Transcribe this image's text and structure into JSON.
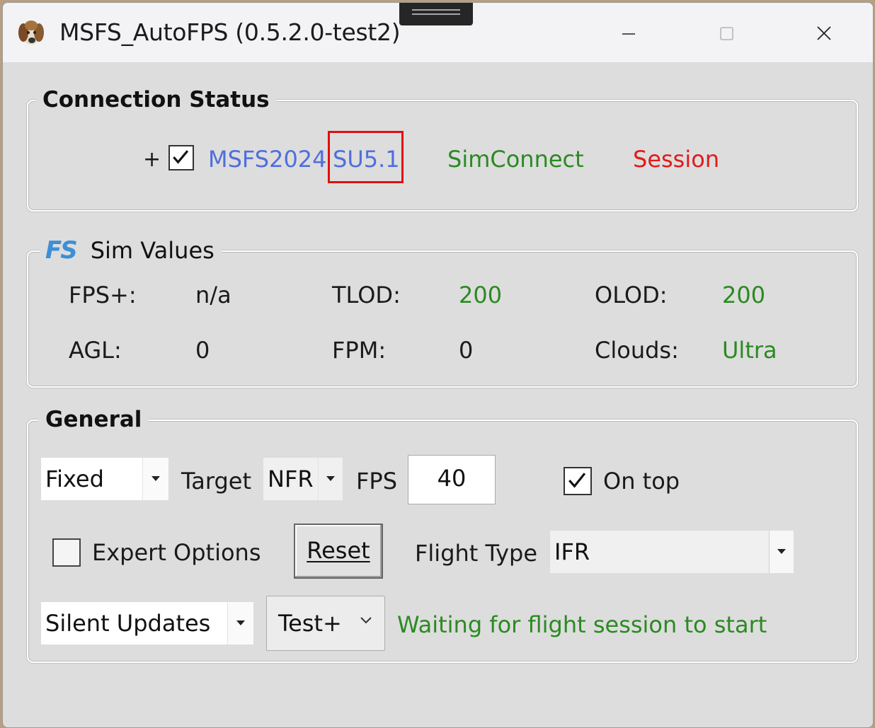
{
  "window": {
    "title": "MSFS_AutoFPS (0.5.2.0-test2)"
  },
  "connection": {
    "legend": "Connection Status",
    "expand": "+",
    "sim_name": "MSFS2024",
    "sim_version": "SU5.1",
    "simconnect": "SimConnect",
    "session": "Session",
    "sim_checked": true
  },
  "sim_values": {
    "legend": "Sim Values",
    "logo_text": "FS",
    "fps_label": "FPS+:",
    "fps_value": "n/a",
    "tlod_label": "TLOD:",
    "tlod_value": "200",
    "olod_label": "OLOD:",
    "olod_value": "200",
    "agl_label": "AGL:",
    "agl_value": "0",
    "fpm_label": "FPM:",
    "fpm_value": "0",
    "clouds_label": "Clouds:",
    "clouds_value": "Ultra"
  },
  "general": {
    "legend": "General",
    "mode_select": "Fixed",
    "target_label": "Target",
    "target_select": "NFR",
    "fps_label": "FPS",
    "fps_input": "40",
    "on_top_label": "On top",
    "on_top_checked": true,
    "expert_label": "Expert Options",
    "expert_checked": false,
    "reset_label": "Reset",
    "flight_type_label": "Flight Type",
    "flight_type_select": "IFR",
    "updates_select": "Silent Updates",
    "channel_select": "Test+",
    "status_message": "Waiting for flight session to start"
  },
  "colors": {
    "blue": "#4f6fdc",
    "green": "#2b8a22",
    "red": "#e01b1b",
    "highlight": "#e01010"
  }
}
